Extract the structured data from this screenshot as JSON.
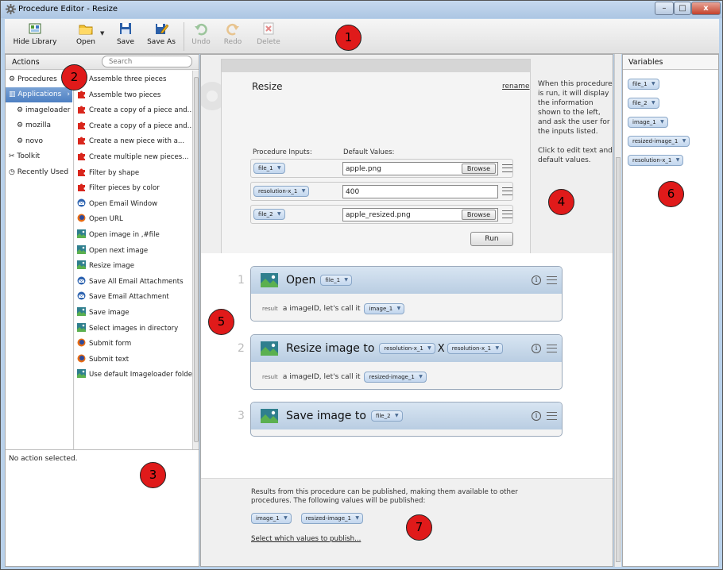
{
  "window": {
    "title": "Procedure Editor - Resize",
    "min": "–",
    "max": "□",
    "close": "x"
  },
  "toolbar": {
    "hide_library": "Hide Library",
    "open": "Open",
    "save": "Save",
    "save_as": "Save As",
    "undo": "Undo",
    "redo": "Redo",
    "delete": "Delete"
  },
  "actions": {
    "header": "Actions",
    "search_placeholder": "Search",
    "categories": [
      "Procedures",
      "Applications",
      "imageloader",
      "mozilla",
      "novo",
      "Toolkit",
      "Recently Used"
    ],
    "items": [
      {
        "label": "Assemble three pieces",
        "icon": "puzzle-icon"
      },
      {
        "label": "Assemble two pieces",
        "icon": "puzzle-icon"
      },
      {
        "label": "Create a copy of a piece and...",
        "icon": "puzzle-icon"
      },
      {
        "label": "Create a copy of a piece and...",
        "icon": "puzzle-icon"
      },
      {
        "label": "Create a new piece with a...",
        "icon": "puzzle-icon"
      },
      {
        "label": "Create multiple new pieces...",
        "icon": "puzzle-icon"
      },
      {
        "label": "Filter by shape",
        "icon": "puzzle-icon"
      },
      {
        "label": "Filter pieces by color",
        "icon": "puzzle-icon"
      },
      {
        "label": "Open Email Window",
        "icon": "thunderbird-icon"
      },
      {
        "label": "Open URL",
        "icon": "firefox-icon"
      },
      {
        "label": "Open image in ,#file",
        "icon": "image-icon"
      },
      {
        "label": "Open next image",
        "icon": "image-icon"
      },
      {
        "label": "Resize image",
        "icon": "image-icon"
      },
      {
        "label": "Save All Email Attachments",
        "icon": "thunderbird-icon"
      },
      {
        "label": "Save Email Attachment",
        "icon": "thunderbird-icon"
      },
      {
        "label": "Save image",
        "icon": "image-icon"
      },
      {
        "label": "Select images in directory",
        "icon": "image-icon"
      },
      {
        "label": "Submit form",
        "icon": "firefox-icon"
      },
      {
        "label": "Submit text",
        "icon": "firefox-icon"
      },
      {
        "label": "Use default Imageloader folder",
        "icon": "image-icon"
      }
    ],
    "no_selection": "No action selected."
  },
  "procedure": {
    "name": "Resize",
    "rename": "rename",
    "inputs_label": "Procedure Inputs:",
    "defaults_label": "Default Values:",
    "inputs": [
      {
        "var": "file_1",
        "value": "apple.png",
        "browse": "Browse"
      },
      {
        "var": "resolution-x_1",
        "value": "400",
        "browse": ""
      },
      {
        "var": "file_2",
        "value": "apple_resized.png",
        "browse": "Browse"
      }
    ],
    "run": "Run",
    "help": [
      "When this procedure is run, it will display the information shown to the left, and ask the user for the inputs listed.",
      "Click to edit text and default values."
    ]
  },
  "steps": [
    {
      "num": "1",
      "title": "Open",
      "params": [
        "file_1"
      ],
      "result_label": "result",
      "result_text": "a imageID, let's call it",
      "result_var": "image_1"
    },
    {
      "num": "2",
      "title": "Resize image to",
      "params": [
        "resolution-x_1",
        "resolution-x_1"
      ],
      "sep": "X",
      "result_label": "result",
      "result_text": "a imageID, let's call it",
      "result_var": "resized-image_1"
    },
    {
      "num": "3",
      "title": "Save image to",
      "params": [
        "file_2"
      ]
    }
  ],
  "publish": {
    "text": "Results from this procedure can be published, making them available to other procedures. The following values will be published:",
    "values": [
      "image_1",
      "resized-image_1"
    ],
    "link": "Select which values to publish..."
  },
  "variables": {
    "header": "Variables",
    "items": [
      "file_1",
      "file_2",
      "image_1",
      "resized-image_1",
      "resolution-x_1"
    ]
  },
  "callouts": [
    "1",
    "2",
    "3",
    "4",
    "5",
    "6",
    "7"
  ]
}
